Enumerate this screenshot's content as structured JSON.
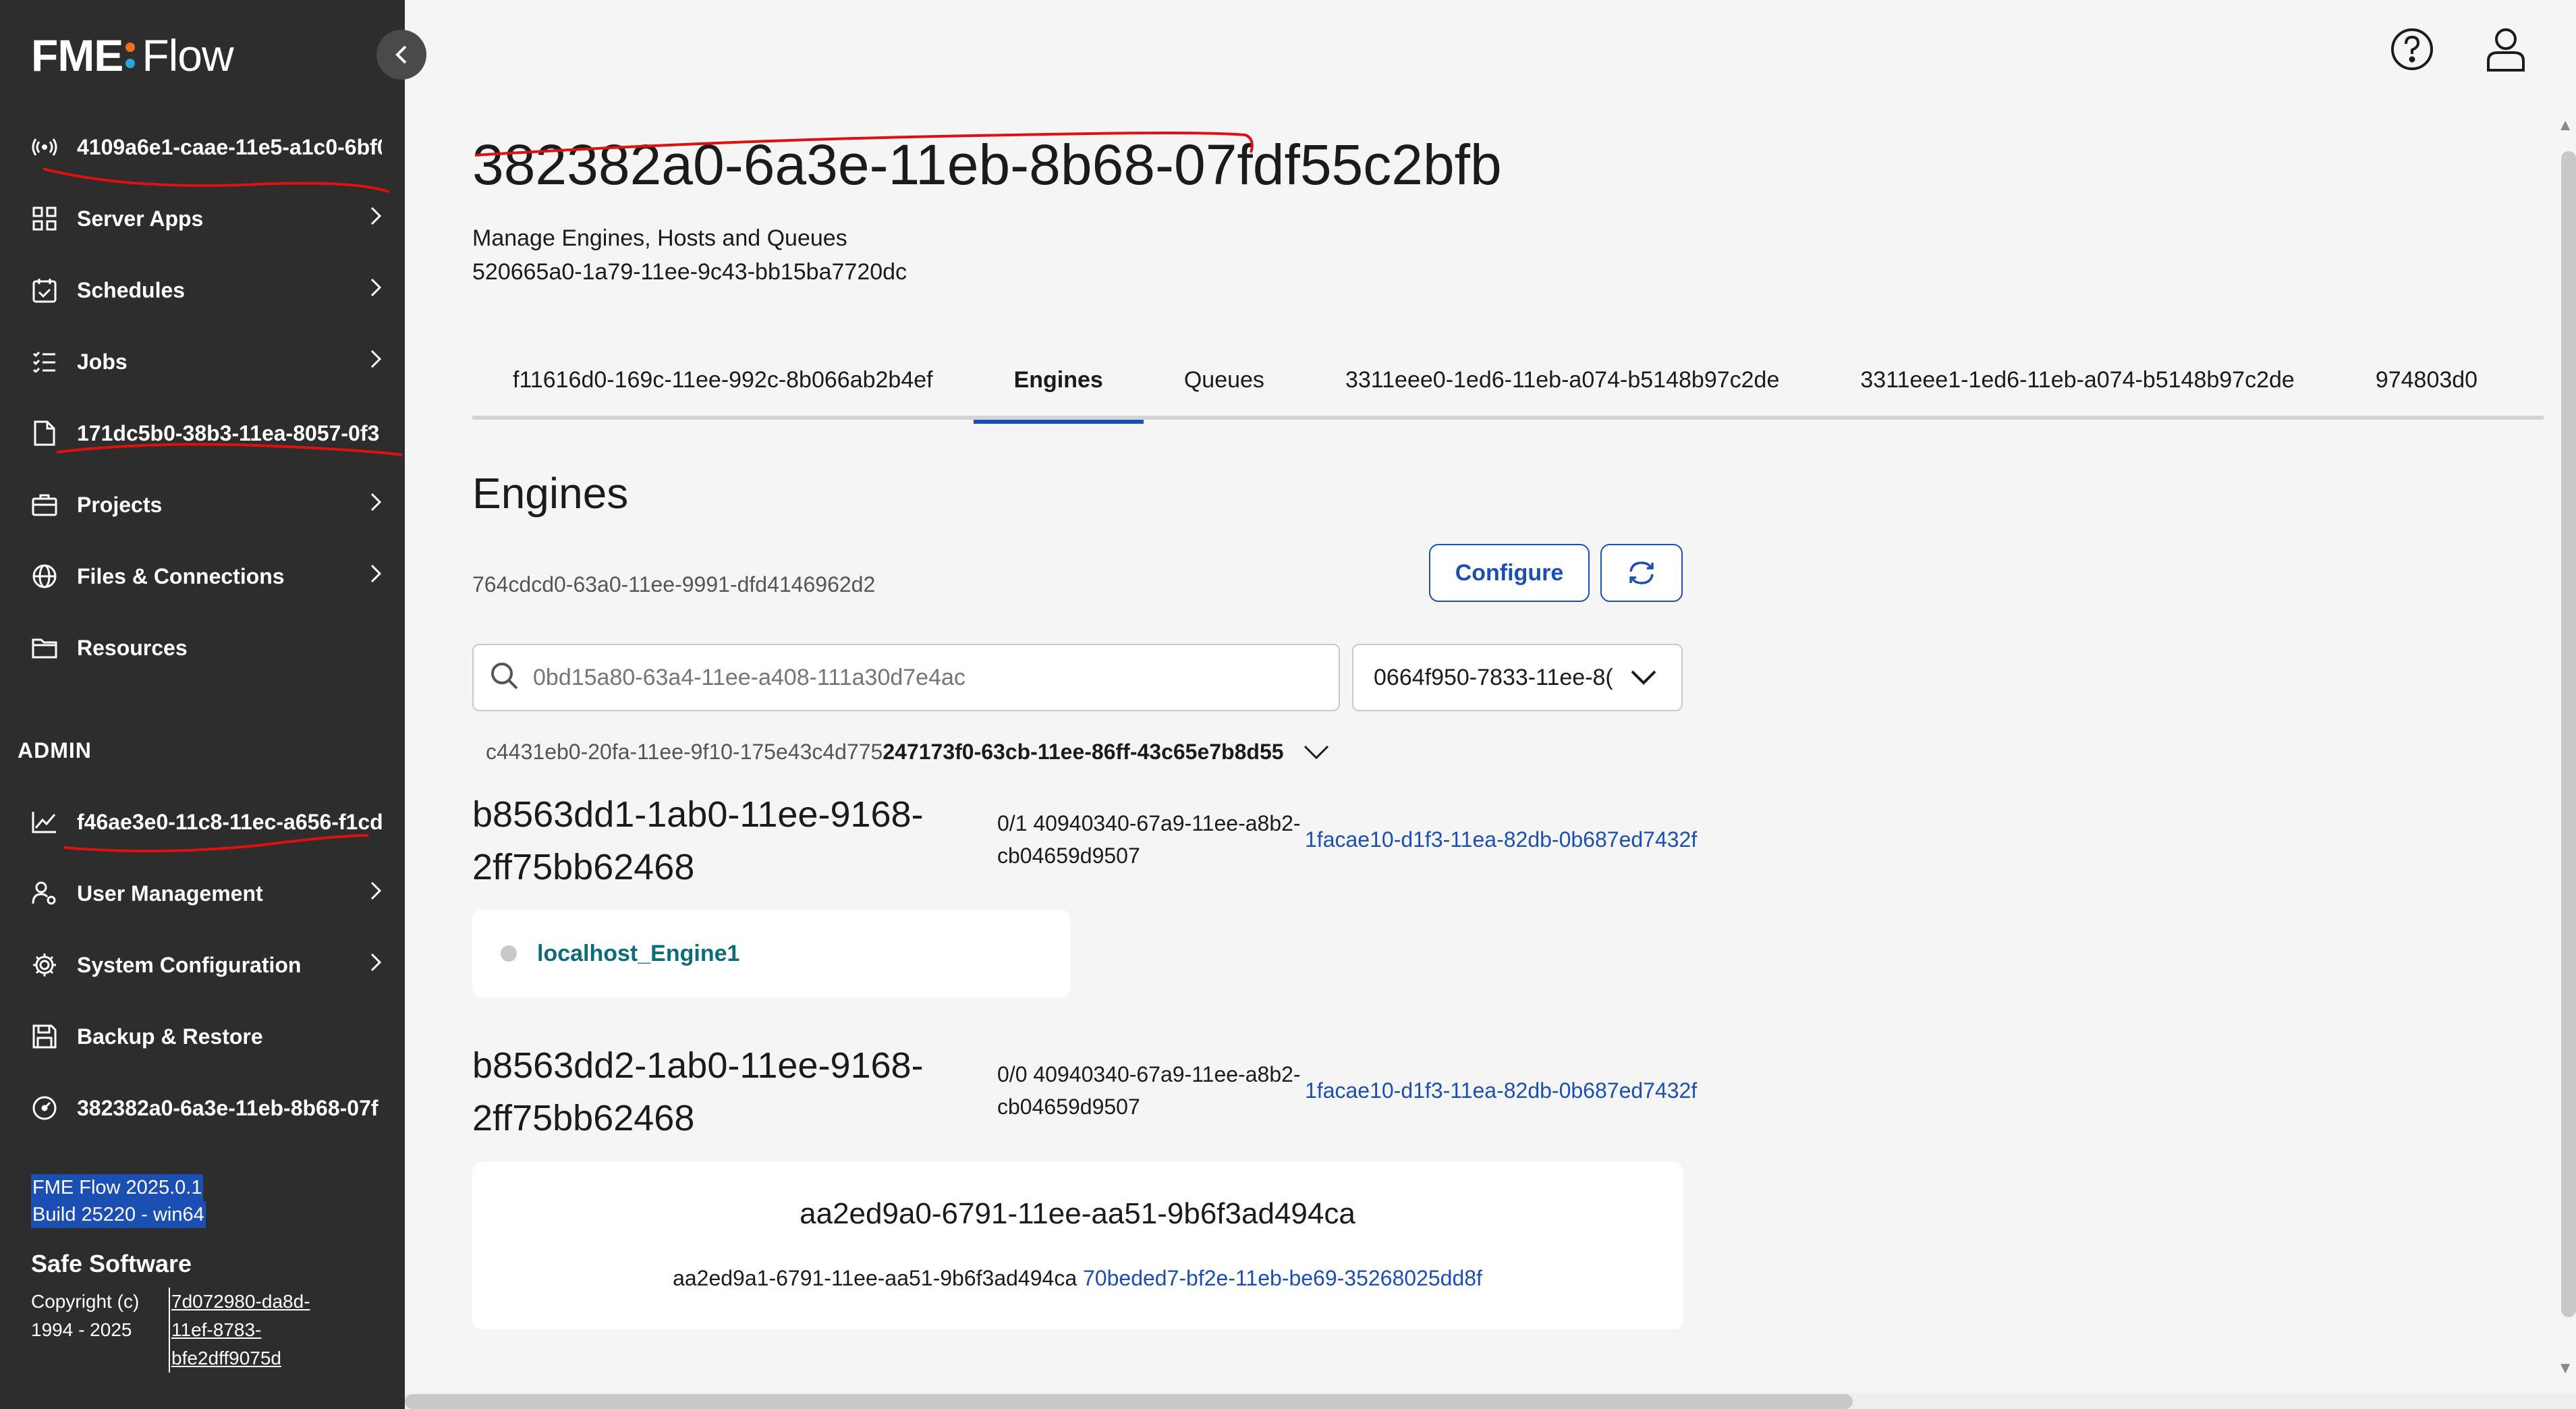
{
  "app": {
    "logo_fme": "FME",
    "logo_flow": "Flow",
    "colors": {
      "sidebar": "#2d2d2d",
      "accent": "#1c4fb4",
      "dot_orange": "#f26f21",
      "dot_blue": "#2ca4dc",
      "engine_link": "#0e6b78"
    }
  },
  "sidebar": {
    "items": [
      {
        "label": "4109a6e1-caae-11e5-a1c0-6bf0",
        "icon": "broadcast-icon",
        "chevron": false
      },
      {
        "label": "Server Apps",
        "icon": "apps-grid-icon",
        "chevron": true
      },
      {
        "label": "Schedules",
        "icon": "calendar-icon",
        "chevron": true
      },
      {
        "label": "Jobs",
        "icon": "list-icon",
        "chevron": true
      },
      {
        "label": "171dc5b0-38b3-11ea-8057-0f3",
        "icon": "document-icon",
        "chevron": false
      },
      {
        "label": "Projects",
        "icon": "briefcase-icon",
        "chevron": true
      },
      {
        "label": "Files & Connections",
        "icon": "globe-icon",
        "chevron": true
      },
      {
        "label": "Resources",
        "icon": "folder-icon",
        "chevron": false
      }
    ],
    "admin_heading": "ADMIN",
    "admin_items": [
      {
        "label": "f46ae3e0-11c8-11ec-a656-f1cd",
        "icon": "chart-line-icon",
        "chevron": false
      },
      {
        "label": "User Management",
        "icon": "user-gear-icon",
        "chevron": true
      },
      {
        "label": "System Configuration",
        "icon": "gear-icon",
        "chevron": true
      },
      {
        "label": "Backup & Restore",
        "icon": "save-icon",
        "chevron": false
      },
      {
        "label": "382382a0-6a3e-11eb-8b68-07f",
        "icon": "gauge-icon",
        "chevron": false
      }
    ],
    "version_line1": "FME Flow 2025.0.1",
    "version_line2": "Build 25220 - win64",
    "safe_software": "Safe Software",
    "copyright_line1": "Copyright (c)",
    "copyright_line2": "1994 - 2025",
    "copyright_link": "7d072980-da8d-11ef-8783-bfe2dff9075d"
  },
  "header": {
    "title": "382382a0-6a3e-11eb-8b68-07fdf55c2bfb",
    "subtitle": "Manage Engines, Hosts and Queues",
    "subid": "520665a0-1a79-11ee-9c43-bb15ba7720dc"
  },
  "tabs": [
    {
      "label": "f11616d0-169c-11ee-992c-8b066ab2b4ef",
      "active": false
    },
    {
      "label": "Engines",
      "active": true
    },
    {
      "label": "Queues",
      "active": false
    },
    {
      "label": "3311eee0-1ed6-11eb-a074-b5148b97c2de",
      "active": false
    },
    {
      "label": "3311eee1-1ed6-11eb-a074-b5148b97c2de",
      "active": false
    },
    {
      "label": "974803d0",
      "active": false
    }
  ],
  "engines": {
    "title": "Engines",
    "description_id": "764cdcd0-63a0-11ee-9991-dfd4146962d2",
    "configure_label": "Configure",
    "search_placeholder": "0bd15a80-63a4-11ee-a408-111a30d7e4ac",
    "select_value": "0664f950-7833-11ee-8(",
    "filter_label": "c4431eb0-20fa-11ee-9f10-175e43c4d775",
    "filter_value": "247173f0-63cb-11ee-86ff-43c65e7b8d55"
  },
  "groups": [
    {
      "title": "b8563dd1-1ab0-11ee-9168-2ff75bb62468",
      "count_text": "0/1 40940340-67a9-11ee-a8b2-cb04659d9507",
      "link": "1facae10-d1f3-11ea-82db-0b687ed7432f",
      "engine_name": "localhost_Engine1"
    },
    {
      "title": "b8563dd2-1ab0-11ee-9168-2ff75bb62468",
      "count_text": "0/0 40940340-67a9-11ee-a8b2-cb04659d9507",
      "link": "1facae10-d1f3-11ea-82db-0b687ed7432f",
      "empty_heading": "aa2ed9a0-6791-11ee-aa51-9b6f3ad494ca",
      "empty_text": "aa2ed9a1-6791-11ee-aa51-9b6f3ad494ca",
      "empty_link": "70beded7-bf2e-11eb-be69-35268025dd8f"
    }
  ]
}
